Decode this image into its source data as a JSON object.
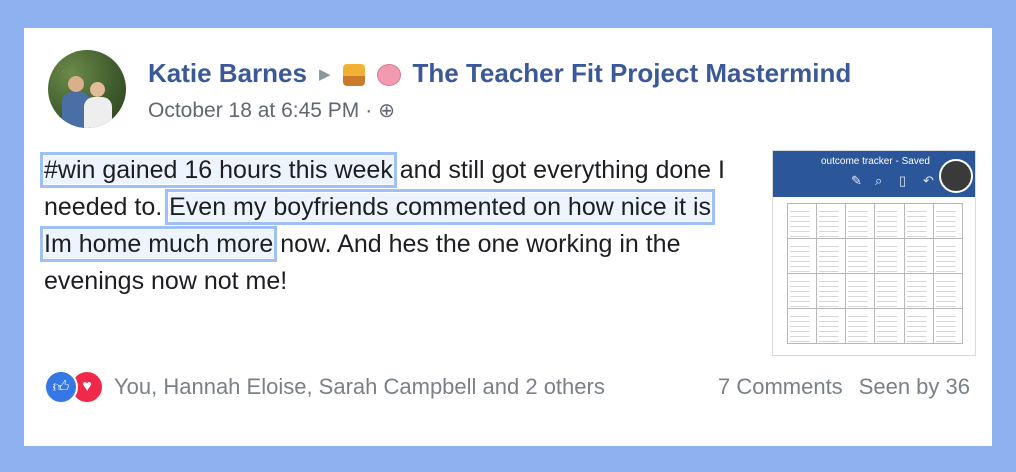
{
  "post": {
    "author": "Katie Barnes",
    "group": "The Teacher Fit Project Mastermind",
    "timestamp": "October 18 at 6:45 PM",
    "separator": "·",
    "text": {
      "part1": "#win gained 16 hours this week",
      "part2": " and still got everything done I needed to. ",
      "part3": "Even my boyfriends commented on how nice it is Im home much more",
      "part4": " now. And hes the one working in the evenings now not me!"
    },
    "attachment": {
      "title": "outcome tracker - Saved"
    }
  },
  "reactions": {
    "names": "You, Hannah Eloise, Sarah Campbell and 2 others",
    "comments": "7 Comments",
    "seen": "Seen by 36"
  },
  "icons": {
    "arrow": "right-triangle-icon",
    "audience": "globe-icon",
    "like": "thumbs-up-icon",
    "love": "heart-icon"
  },
  "colors": {
    "accent": "#3b5998",
    "frame": "#8eb1f0",
    "highlight": "#9ec0f7",
    "like": "#3578e5",
    "love": "#f0284a"
  }
}
